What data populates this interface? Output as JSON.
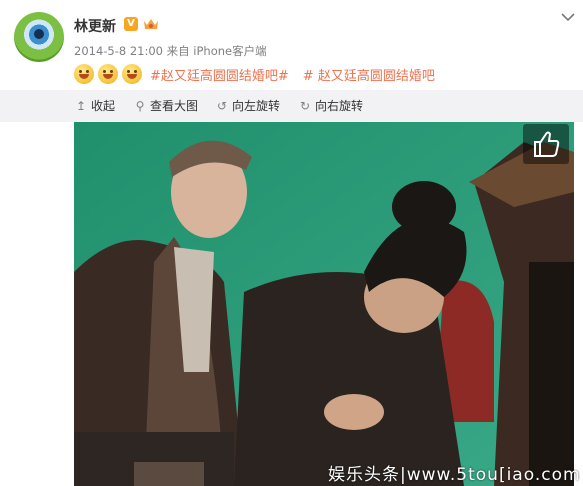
{
  "user": {
    "name": "林更新",
    "verified_badge": "V"
  },
  "post": {
    "meta": "2014-5-8 21:00 来自 iPhone客户端",
    "emojis": [
      "smile-emoji",
      "smile-emoji",
      "smile-emoji"
    ],
    "hashtag_1": "#赵又廷高圆圆结婚吧#",
    "hashtag_2": "# 赵又廷高圆圆结婚吧"
  },
  "toolbar": {
    "collapse_label": "收起",
    "view_large_label": "查看大图",
    "rotate_left_label": "向左旋转",
    "rotate_right_label": "向右旋转"
  },
  "photo": {
    "watermark": "娱乐头条|www.5tou[iao.com"
  },
  "colors": {
    "link": "#eb7350",
    "toolbar_bg": "#f2f2f5",
    "badge": "#f6a623"
  }
}
